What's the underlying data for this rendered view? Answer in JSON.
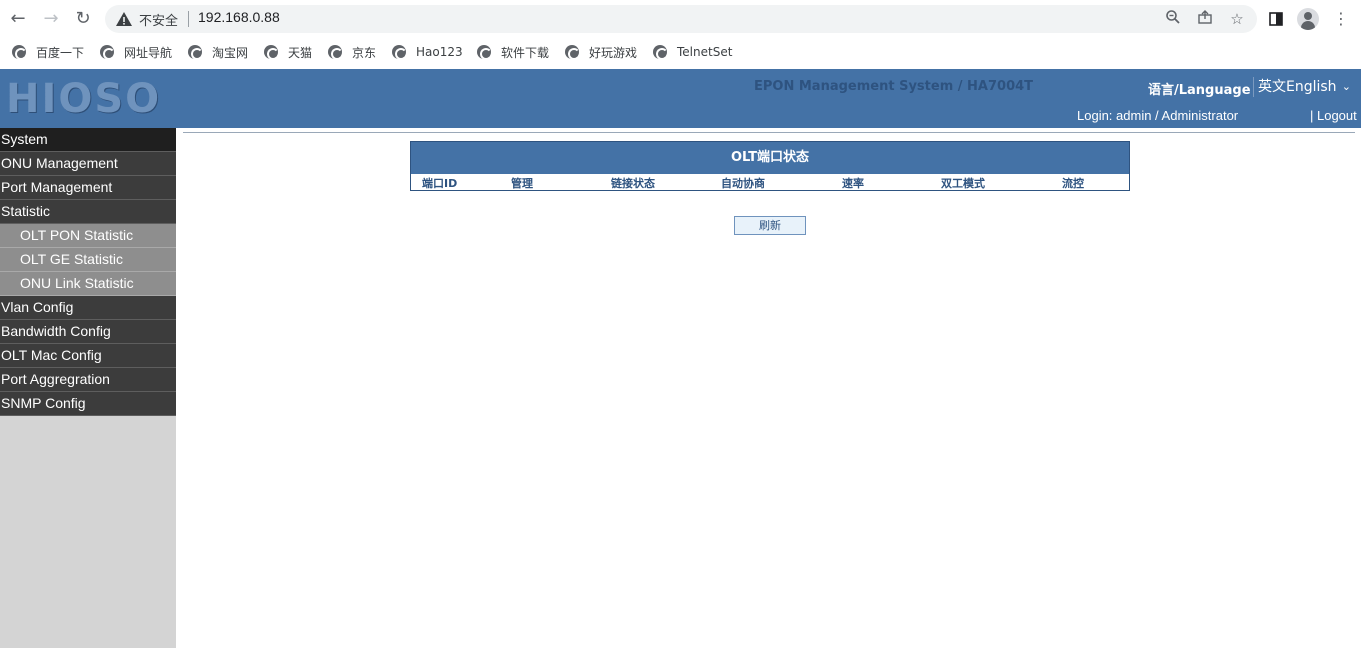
{
  "browser": {
    "security_label": "不安全",
    "url": "192.168.0.88"
  },
  "bookmarks": [
    {
      "label": "百度一下"
    },
    {
      "label": "网址导航"
    },
    {
      "label": "淘宝网"
    },
    {
      "label": "天猫"
    },
    {
      "label": "京东"
    },
    {
      "label": "Hao123"
    },
    {
      "label": "软件下载"
    },
    {
      "label": "好玩游戏"
    },
    {
      "label": "TelnetSet"
    }
  ],
  "header": {
    "logo": "HIOSO",
    "system_title": "EPON Management System / HA7004T",
    "language_label": "语言/Language",
    "language_selected": "英文English",
    "login_info": "Login: admin / Administrator",
    "logout": "| Logout"
  },
  "sidebar": {
    "items": [
      {
        "label": "System"
      },
      {
        "label": "ONU Management"
      },
      {
        "label": "Port Management"
      },
      {
        "label": "Statistic"
      },
      {
        "label": "OLT PON Statistic"
      },
      {
        "label": "OLT GE Statistic"
      },
      {
        "label": "ONU Link Statistic"
      },
      {
        "label": "Vlan Config"
      },
      {
        "label": "Bandwidth Config"
      },
      {
        "label": "OLT Mac Config"
      },
      {
        "label": "Port Aggregration"
      },
      {
        "label": "SNMP Config"
      }
    ]
  },
  "port_table": {
    "title": "OLT端口状态",
    "columns": [
      "端口ID",
      "管理",
      "链接状态",
      "自动协商",
      "速率",
      "双工模式",
      "流控"
    ]
  },
  "refresh_button": "刷新"
}
